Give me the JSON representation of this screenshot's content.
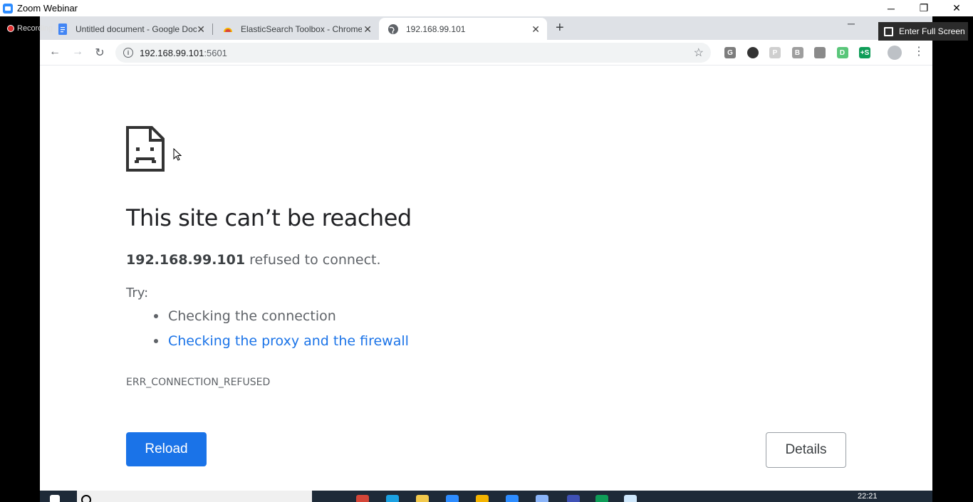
{
  "zoom": {
    "title": "Zoom Webinar",
    "recording_label": "Recording",
    "fullscreen_label": "Enter Full Screen",
    "window_controls": [
      "─",
      "❐",
      "✕"
    ]
  },
  "browser": {
    "tabs": [
      {
        "label": "Untitled document - Google Doc",
        "icon": "google-docs-icon",
        "active": false
      },
      {
        "label": "ElasticSearch Toolbox - Chrome W",
        "icon": "elasticsearch-icon",
        "active": false
      },
      {
        "label": "192.168.99.101",
        "icon": "globe-icon",
        "active": true
      }
    ],
    "url_host": "192.168.99.101",
    "url_port": ":5601",
    "extensions": [
      {
        "name": "grammarly-extension-icon",
        "letter": "G",
        "color": "#7d7d7d"
      },
      {
        "name": "circle-extension-icon",
        "letter": "",
        "color": "#333333"
      },
      {
        "name": "p-extension-icon",
        "letter": "P",
        "color": "#cfcfcf"
      },
      {
        "name": "b-extension-icon",
        "letter": "B",
        "color": "#9e9e9e"
      },
      {
        "name": "edit-extension-icon",
        "letter": "",
        "color": "#8a8a8a"
      },
      {
        "name": "d-extension-icon",
        "letter": "D",
        "color": "#5ac67a"
      },
      {
        "name": "plus-s-extension-icon",
        "letter": "+S",
        "color": "#0f9d58"
      }
    ]
  },
  "error_page": {
    "headline": "This site can’t be reached",
    "host": "192.168.99.101",
    "message": "refused to connect.",
    "try_label": "Try:",
    "suggestion_1": "Checking the connection",
    "suggestion_2": "Checking the proxy and the firewall",
    "error_code": "ERR_CONNECTION_REFUSED",
    "reload_label": "Reload",
    "details_label": "Details"
  },
  "taskbar": {
    "time": "22:21"
  }
}
